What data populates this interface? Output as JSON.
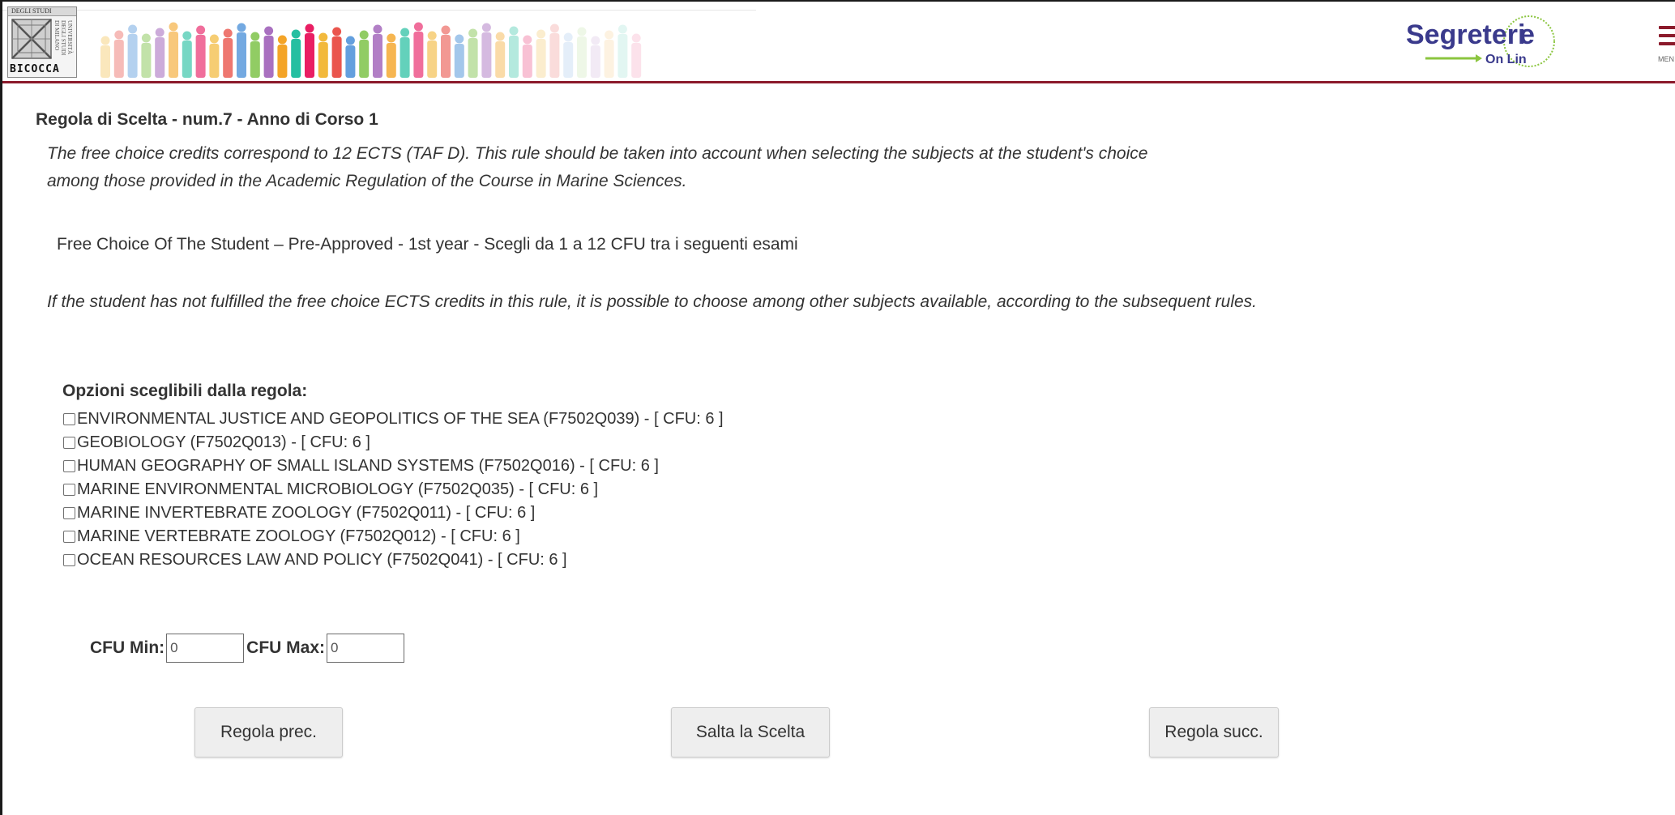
{
  "header": {
    "university_logo": {
      "top_text": "DEGLI STUDI",
      "side_text": "UNIVERSITÀ DEGLI STUDI DI MILANO",
      "name": "BICOCCA"
    },
    "segreterie_logo": {
      "text_main": "Segreteri",
      "text_sub": "On Lin",
      "accent_color": "#8bc53f",
      "brand_color": "#3a3a8c"
    },
    "menu_label": "MEN",
    "accent_color": "#8b1a2b"
  },
  "rule": {
    "title": "Regola di Scelta - num.7 - Anno di Corso 1",
    "description_line1": "The free choice credits correspond to 12 ECTS (TAF D). This rule should be taken into account when selecting the subjects at the student's choice",
    "description_line2": "among those provided in the Academic Regulation of the Course in Marine Sciences.",
    "subtitle": "Free Choice Of The Student – Pre-Approved - 1st year - Scegli da 1 a 12 CFU tra i seguenti esami",
    "note": "If the student has not fulfilled the free choice ECTS credits in this rule, it is possible to choose among other subjects available, according to the subsequent rules."
  },
  "options": {
    "heading": "Opzioni sceglibili dalla regola:",
    "items": [
      {
        "label": "ENVIRONMENTAL JUSTICE AND GEOPOLITICS OF THE SEA (F7502Q039) - [ CFU: 6 ]",
        "checked": false
      },
      {
        "label": "GEOBIOLOGY (F7502Q013) - [ CFU: 6 ]",
        "checked": false
      },
      {
        "label": "HUMAN GEOGRAPHY OF SMALL ISLAND SYSTEMS (F7502Q016) - [ CFU: 6 ]",
        "checked": false
      },
      {
        "label": "MARINE ENVIRONMENTAL MICROBIOLOGY (F7502Q035) - [ CFU: 6 ]",
        "checked": false
      },
      {
        "label": "MARINE INVERTEBRATE ZOOLOGY (F7502Q011) - [ CFU: 6 ]",
        "checked": false
      },
      {
        "label": "MARINE VERTEBRATE ZOOLOGY (F7502Q012) - [ CFU: 6 ]",
        "checked": false
      },
      {
        "label": "OCEAN RESOURCES LAW AND POLICY (F7502Q041) - [ CFU: 6 ]",
        "checked": false
      }
    ]
  },
  "cfu": {
    "min_label": "CFU Min:",
    "min_value": "0",
    "max_label": "CFU Max:",
    "max_value": "0"
  },
  "buttons": {
    "prev": "Regola prec.",
    "skip": "Salta la Scelta",
    "next": "Regola succ."
  }
}
